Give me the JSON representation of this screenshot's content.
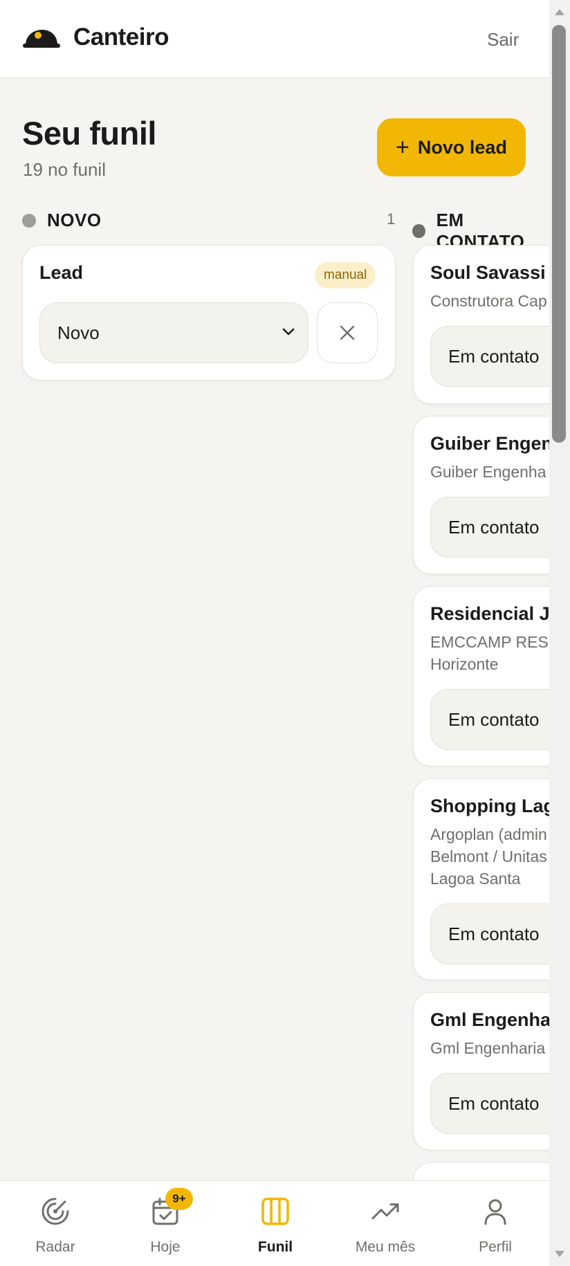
{
  "app": {
    "brand": "Canteiro",
    "logout_label": "Sair"
  },
  "page": {
    "title": "Seu funil",
    "subtitle": "19 no funil",
    "new_lead_label": "Novo lead"
  },
  "columns": [
    {
      "title": "NOVO",
      "count": "1",
      "dot_color": "#9e9d99",
      "cards": [
        {
          "title": "Lead",
          "badge": "manual",
          "stage": "Novo"
        }
      ]
    },
    {
      "title": "EM CONTATO",
      "dot_color": "#6f6e6a",
      "cards": [
        {
          "title": "Soul Savassi",
          "subtitle": [
            "Construtora Cap"
          ],
          "stage": "Em contato"
        },
        {
          "title": "Guiber Engenharia",
          "subtitle": [
            "Guiber Engenha"
          ],
          "stage": "Em contato"
        },
        {
          "title": "Residencial J",
          "subtitle": [
            "EMCCAMP RESI",
            "Horizonte"
          ],
          "stage": "Em contato"
        },
        {
          "title": "Shopping Lagoa",
          "subtitle": [
            "Argoplan (admin",
            "Belmont / Unitas",
            "Lagoa Santa"
          ],
          "stage": "Em contato"
        },
        {
          "title": "Gml Engenharia",
          "subtitle": [
            "Gml Engenharia"
          ],
          "stage": "Em contato"
        }
      ]
    }
  ],
  "nav": {
    "items": [
      {
        "label": "Radar",
        "icon": "radar-icon"
      },
      {
        "label": "Hoje",
        "icon": "calendar-check-icon",
        "badge": "9+"
      },
      {
        "label": "Funil",
        "icon": "columns-icon",
        "active": true
      },
      {
        "label": "Meu mês",
        "icon": "trending-up-icon"
      },
      {
        "label": "Perfil",
        "icon": "user-icon"
      }
    ]
  },
  "colors": {
    "accent": "#f2b705",
    "background": "#f5f4f0",
    "text": "#1c1b19",
    "muted": "#6f6e6a"
  }
}
